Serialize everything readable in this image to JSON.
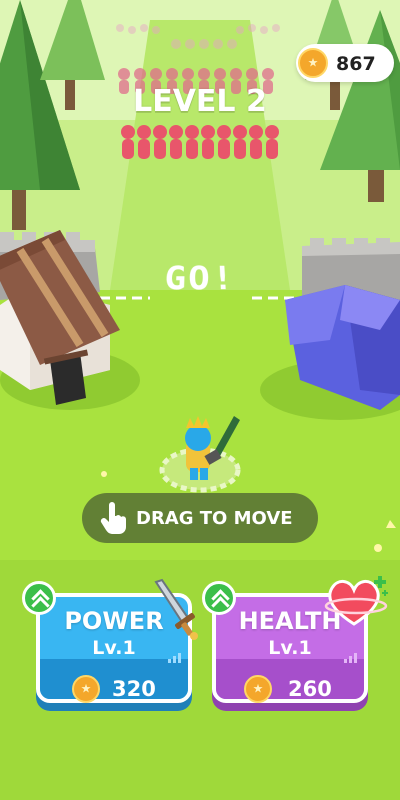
{
  "hud": {
    "coins": "867",
    "level_label": "LEVEL 2"
  },
  "ground_text": "GO!",
  "hint": {
    "label": "DRAG TO MOVE",
    "icon": "hand-pointer-icon"
  },
  "upgrades": [
    {
      "title": "POWER",
      "level": "Lv.1",
      "price": "320",
      "icon": "sword-icon",
      "color": "#39b6f2"
    },
    {
      "title": "HEALTH",
      "level": "Lv.1",
      "price": "260",
      "icon": "heart-icon",
      "color": "#c46de6"
    }
  ],
  "colors": {
    "grass": "#a9e23f",
    "enemy": "#e8566b",
    "power_card": "#39b6f2",
    "health_card": "#c46de6",
    "upgrade_badge": "#3bbf4a",
    "coin": "#f4a72b"
  }
}
